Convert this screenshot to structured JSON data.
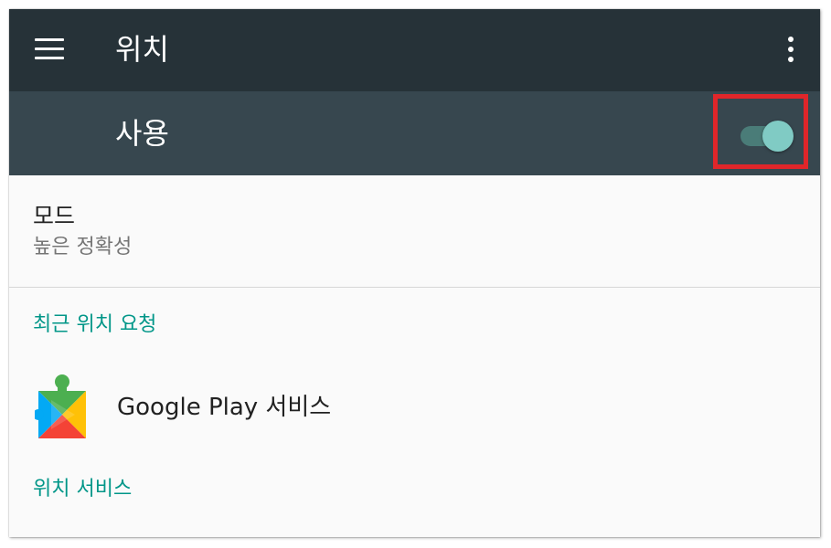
{
  "app_bar": {
    "title": "위치",
    "menu_icon": "hamburger-menu-icon",
    "overflow_icon": "more-vert-icon"
  },
  "master_switch": {
    "label": "사용",
    "state": "on",
    "highlighted": true
  },
  "mode": {
    "title": "모드",
    "summary": "높은 정확성"
  },
  "recent_requests": {
    "header": "최근 위치 요청",
    "items": [
      {
        "label": "Google Play 서비스",
        "icon": "google-play-services-icon"
      }
    ]
  },
  "location_services": {
    "header": "위치 서비스"
  },
  "colors": {
    "app_bar": "#263238",
    "switch_bar": "#37474f",
    "accent": "#009688",
    "switch_thumb": "#80cbc4",
    "highlight": "#e0262a"
  }
}
